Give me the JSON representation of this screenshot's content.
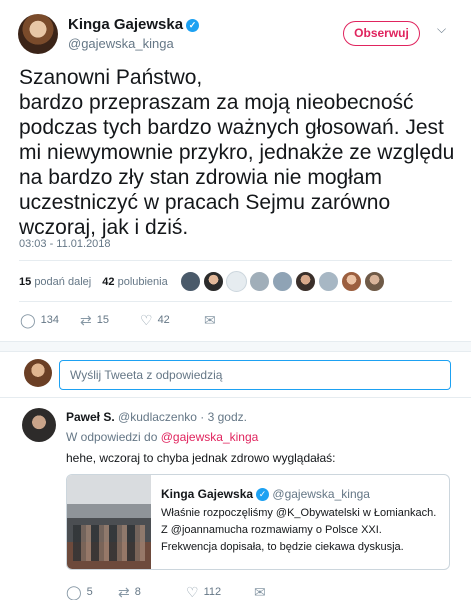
{
  "tweet": {
    "author_name": "Kinga Gajewska",
    "author_handle": "@gajewska_kinga",
    "follow_label": "Obserwuj",
    "text": "Szanowni Państwo,\nbardzo przepraszam za moją nieobecność podczas tych bardzo ważnych głosowań. Jest mi niewymownie przykro, jednakże ze względu na bardzo zły stan zdrowia nie mogłam uczestniczyć w pracach Sejmu zarówno wczoraj, jak i dziś.",
    "timestamp": "03:03 - 11.01.2018",
    "retweets_count": "15",
    "retweets_label": "podań dalej",
    "likes_count": "42",
    "likes_label": "polubienia",
    "actions": {
      "replies": "134",
      "retweets": "15",
      "likes": "42"
    }
  },
  "reply_bar": {
    "placeholder": "Wyślij Tweeta z odpowiedzią"
  },
  "reply": {
    "author_name": "Paweł S.",
    "author_handle": "@kudlaczenko",
    "time": "· 3 godz.",
    "context_prefix": "W odpowiedzi do",
    "context_mention": "@gajewska_kinga",
    "text": "hehe, wczoraj to chyba jednak zdrowo wyglądałaś:",
    "quote": {
      "author_name": "Kinga Gajewska",
      "author_handle": "@gajewska_kinga",
      "text": "Właśnie rozpoczęliśmy @K_Obywatelski w Łomiankach.  Z @joannamucha rozmawiamy o Polsce XXI. Frekwencja dopisała, to będzie ciekawa dyskusja."
    },
    "actions": {
      "replies": "5",
      "retweets": "8",
      "likes": "112"
    }
  },
  "colors": {
    "accent": "#e0245e",
    "link": "#1da1f2",
    "muted": "#657786"
  }
}
